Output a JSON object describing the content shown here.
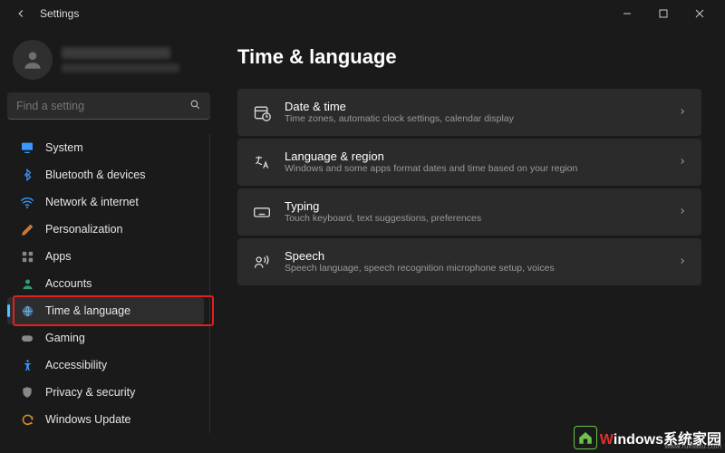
{
  "window": {
    "title": "Settings"
  },
  "profile": {
    "name_redacted": true,
    "email_redacted": true
  },
  "search": {
    "placeholder": "Find a setting"
  },
  "sidebar": {
    "items": [
      {
        "label": "System",
        "icon": "system"
      },
      {
        "label": "Bluetooth & devices",
        "icon": "bluetooth"
      },
      {
        "label": "Network & internet",
        "icon": "network"
      },
      {
        "label": "Personalization",
        "icon": "personalization"
      },
      {
        "label": "Apps",
        "icon": "apps"
      },
      {
        "label": "Accounts",
        "icon": "accounts"
      },
      {
        "label": "Time & language",
        "icon": "time-language",
        "selected": true,
        "highlighted": true
      },
      {
        "label": "Gaming",
        "icon": "gaming"
      },
      {
        "label": "Accessibility",
        "icon": "accessibility"
      },
      {
        "label": "Privacy & security",
        "icon": "privacy"
      },
      {
        "label": "Windows Update",
        "icon": "update"
      }
    ]
  },
  "page": {
    "title": "Time & language",
    "cards": [
      {
        "title": "Date & time",
        "subtitle": "Time zones, automatic clock settings, calendar display"
      },
      {
        "title": "Language & region",
        "subtitle": "Windows and some apps format dates and time based on your region"
      },
      {
        "title": "Typing",
        "subtitle": "Touch keyboard, text suggestions, preferences"
      },
      {
        "title": "Speech",
        "subtitle": "Speech language, speech recognition microphone setup, voices"
      }
    ]
  },
  "watermark": {
    "brand_prefix": "W",
    "brand_rest": "indows系统家园",
    "url": "www.ruihaitu.com"
  },
  "colors": {
    "accent": "#4cc2ff",
    "highlight_border": "#e02020",
    "card_bg": "#2b2b2b",
    "bg": "#1a1a1a"
  }
}
